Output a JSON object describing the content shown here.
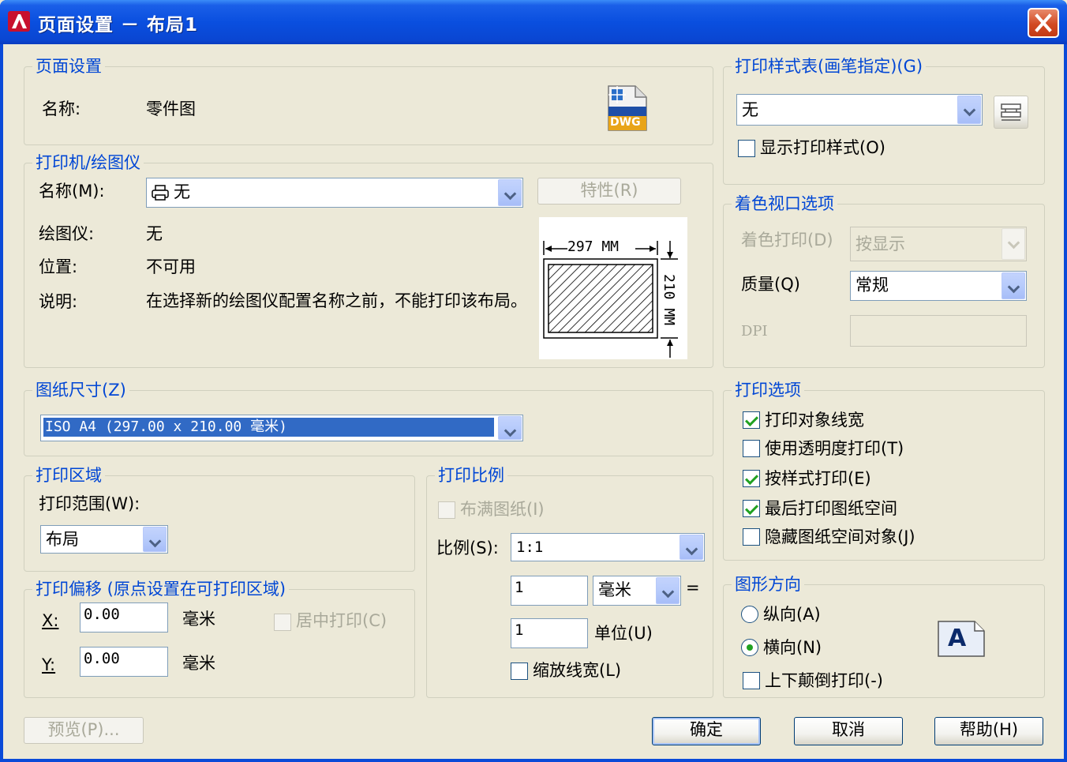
{
  "window": {
    "title": "页面设置 － 布局1"
  },
  "page_setup": {
    "group_title": "页面设置",
    "name_label": "名称:",
    "name_value": "零件图",
    "file_badge": "DWG"
  },
  "printer": {
    "group_title": "打印机/绘图仪",
    "name_label": "名称(M):",
    "name_value": "无",
    "properties_button": "特性(R)",
    "plotter_label": "绘图仪:",
    "plotter_value": "无",
    "location_label": "位置:",
    "location_value": "不可用",
    "description_label": "说明:",
    "description_value": "在选择新的绘图仪配置名称之前，不能打印该布局。",
    "preview": {
      "width_label": "297  MM",
      "height_label": "210  MM"
    }
  },
  "paper_size": {
    "group_title": "图纸尺寸(Z)",
    "value": "ISO A4 (297.00 x 210.00 毫米)"
  },
  "plot_area": {
    "group_title": "打印区域",
    "range_label": "打印范围(W):",
    "range_value": "布局"
  },
  "plot_offset": {
    "group_title": "打印偏移 (原点设置在可打印区域)",
    "x_label": "X:",
    "x_value": "0.00",
    "x_unit": "毫米",
    "y_label": "Y:",
    "y_value": "0.00",
    "y_unit": "毫米",
    "center_label": "居中打印(C)"
  },
  "plot_scale": {
    "group_title": "打印比例",
    "fit_label": "布满图纸(I)",
    "scale_label": "比例(S):",
    "scale_value": "1:1",
    "mm_value": "1",
    "unit_value": "毫米",
    "equals": "=",
    "units_value": "1",
    "units_label": "单位(U)",
    "scale_lineweights": "缩放线宽(L)"
  },
  "plot_style": {
    "group_title": "打印样式表(画笔指定)(G)",
    "value": "无",
    "show_label": "显示打印样式(O)"
  },
  "shaded": {
    "group_title": "着色视口选项",
    "shade_label": "着色打印(D)",
    "shade_value": "按显示",
    "quality_label": "质量(Q)",
    "quality_value": "常规",
    "dpi_label": "DPI"
  },
  "options": {
    "group_title": "打印选项",
    "items": [
      {
        "label": "打印对象线宽",
        "checked": true
      },
      {
        "label": "使用透明度打印(T)",
        "checked": false
      },
      {
        "label": "按样式打印(E)",
        "checked": true
      },
      {
        "label": "最后打印图纸空间",
        "checked": true
      },
      {
        "label": "隐藏图纸空间对象(J)",
        "checked": false
      }
    ]
  },
  "orientation": {
    "group_title": "图形方向",
    "portrait": "纵向(A)",
    "landscape": "横向(N)",
    "upside_down": "上下颠倒打印(-)",
    "icon_letter": "A"
  },
  "buttons": {
    "preview": "预览(P)...",
    "ok": "确定",
    "cancel": "取消",
    "help": "帮助(H)"
  },
  "colors": {
    "titlebar": "#0a4fdf",
    "group_title": "#0046d5",
    "face": "#ece9d8",
    "check": "#21a121"
  }
}
